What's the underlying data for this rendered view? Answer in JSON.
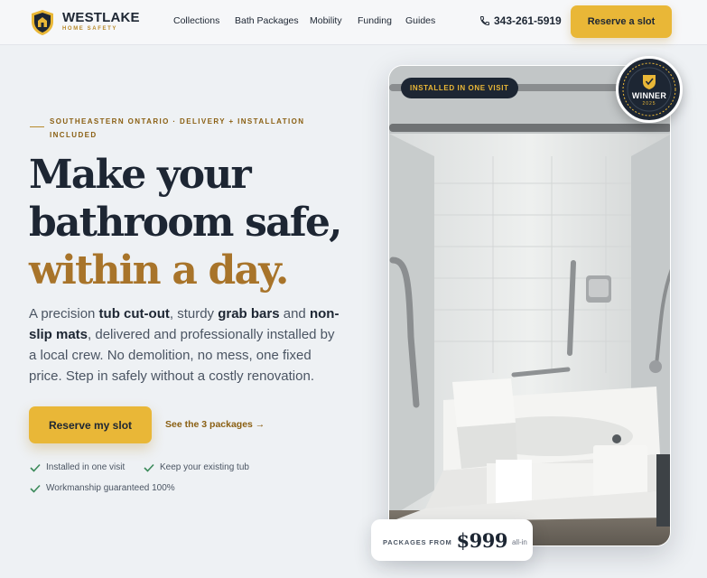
{
  "header": {
    "brand_name": "WESTLAKE",
    "brand_sub": "HOME SAFETY",
    "nav": [
      "Collections",
      "Bath Packages",
      "Mobility",
      "Funding",
      "Guides"
    ],
    "phone": "343-261-5919",
    "cta_label": "Reserve a slot"
  },
  "hero": {
    "eyebrow": "SOUTHEASTERN ONTARIO · DELIVERY + INSTALLATION INCLUDED",
    "headline_line1": "Make your",
    "headline_line2": "bathroom safe,",
    "headline_accent": "within a day.",
    "lead": {
      "p1": "A precision ",
      "b1": "tub cut-out",
      "p2": ", sturdy ",
      "b2": "grab bars",
      "p3": " and ",
      "b3": "non-slip mats",
      "p4": ", delivered and professionally installed by a local crew. No demolition, no mess, one fixed price. Step in safely without a costly renovation."
    },
    "primary_cta": "Reserve my slot",
    "secondary_link": "See the 3 packages →",
    "checks": [
      "Installed in one visit",
      "Keep your existing tub",
      "Workmanship guaranteed 100%"
    ]
  },
  "media": {
    "badge": "INSTALLED IN ONE VISIT",
    "award_word": "WINNER",
    "award_year": "2025",
    "price_label": "PACKAGES FROM",
    "price_value": "$999",
    "price_note": "all-in"
  },
  "colors": {
    "accent": "#e9b737",
    "accent_dark": "#a8742a",
    "ink": "#1d2633",
    "background": "#eef1f4"
  },
  "icons": {
    "logo": "shield-logo-icon",
    "phone": "phone-icon",
    "check": "check-icon",
    "award": "award-badge-icon"
  }
}
